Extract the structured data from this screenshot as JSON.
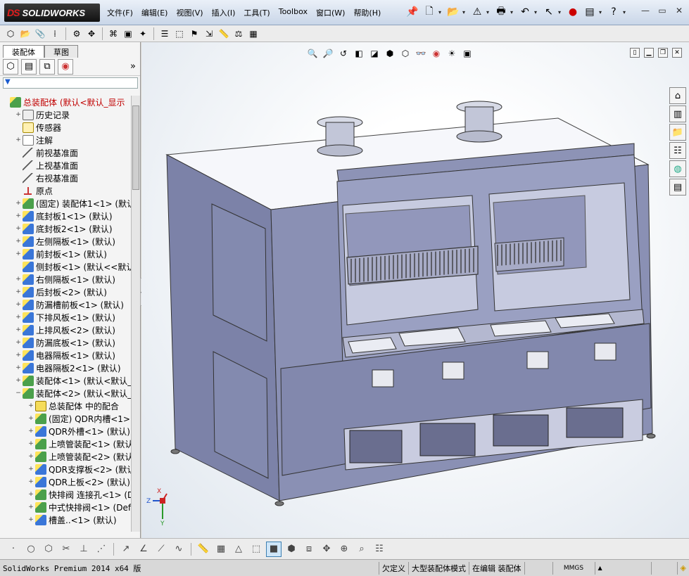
{
  "app": {
    "logo_prefix": "DS",
    "logo_text": "SOLIDWORKS"
  },
  "menu": [
    {
      "label": "文件(F)"
    },
    {
      "label": "编辑(E)"
    },
    {
      "label": "视图(V)"
    },
    {
      "label": "插入(I)"
    },
    {
      "label": "工具(T)"
    },
    {
      "label": "Toolbox"
    },
    {
      "label": "窗口(W)"
    },
    {
      "label": "帮助(H)"
    }
  ],
  "left_panel": {
    "tabs": [
      {
        "label": "装配体"
      },
      {
        "label": "草图"
      }
    ],
    "filter_icon": "filter-icon",
    "tree": [
      {
        "indent": 0,
        "expander": "",
        "icon": "asm",
        "label": "总装配体  (默认<默认_显示",
        "color": "#c00000"
      },
      {
        "indent": 1,
        "expander": "+",
        "icon": "hist",
        "label": "历史记录"
      },
      {
        "indent": 1,
        "expander": "",
        "icon": "sensor",
        "label": "传感器"
      },
      {
        "indent": 1,
        "expander": "+",
        "icon": "note",
        "label": "注解"
      },
      {
        "indent": 1,
        "expander": "",
        "icon": "plane",
        "label": "前视基准面"
      },
      {
        "indent": 1,
        "expander": "",
        "icon": "plane",
        "label": "上视基准面"
      },
      {
        "indent": 1,
        "expander": "",
        "icon": "plane",
        "label": "右视基准面"
      },
      {
        "indent": 1,
        "expander": "",
        "icon": "origin",
        "label": "原点"
      },
      {
        "indent": 1,
        "expander": "+",
        "icon": "asm",
        "label": "(固定) 装配体1<1> (默认<"
      },
      {
        "indent": 1,
        "expander": "+",
        "icon": "part",
        "label": "底封板1<1> (默认)"
      },
      {
        "indent": 1,
        "expander": "+",
        "icon": "part",
        "label": "底封板2<1> (默认)"
      },
      {
        "indent": 1,
        "expander": "+",
        "icon": "part",
        "label": "左侧隔板<1> (默认)"
      },
      {
        "indent": 1,
        "expander": "+",
        "icon": "part",
        "label": "前封板<1> (默认)"
      },
      {
        "indent": 1,
        "expander": "",
        "icon": "part",
        "label": "侧封板<1> (默认<<默认>_显"
      },
      {
        "indent": 1,
        "expander": "+",
        "icon": "part",
        "label": "右侧隔板<1> (默认)"
      },
      {
        "indent": 1,
        "expander": "+",
        "icon": "part",
        "label": "后封板<2> (默认)"
      },
      {
        "indent": 1,
        "expander": "+",
        "icon": "part",
        "label": "防漏槽前板<1> (默认)"
      },
      {
        "indent": 1,
        "expander": "+",
        "icon": "part",
        "label": "下排风板<1> (默认)"
      },
      {
        "indent": 1,
        "expander": "+",
        "icon": "part",
        "label": "上排风板<2> (默认)"
      },
      {
        "indent": 1,
        "expander": "+",
        "icon": "part",
        "label": "防漏底板<1> (默认)"
      },
      {
        "indent": 1,
        "expander": "+",
        "icon": "part",
        "label": "电器隔板<1> (默认)"
      },
      {
        "indent": 1,
        "expander": "+",
        "icon": "part",
        "label": "电器隔板2<1> (默认)"
      },
      {
        "indent": 1,
        "expander": "+",
        "icon": "asm",
        "label": "装配体<1> (默认<默认_显"
      },
      {
        "indent": 1,
        "expander": "−",
        "icon": "asm",
        "label": "装配体<2> (默认<默认_显"
      },
      {
        "indent": 2,
        "expander": "+",
        "icon": "mate",
        "label": "总装配体 中的配合"
      },
      {
        "indent": 2,
        "expander": "+",
        "icon": "asm",
        "label": "(固定) QDR内槽<1> (默"
      },
      {
        "indent": 2,
        "expander": "+",
        "icon": "part",
        "label": "QDR外槽<1> (默认)"
      },
      {
        "indent": 2,
        "expander": "+",
        "icon": "asm",
        "label": "上喷管装配<1> (默认<"
      },
      {
        "indent": 2,
        "expander": "+",
        "icon": "asm",
        "label": "上喷管装配<2> (默认<"
      },
      {
        "indent": 2,
        "expander": "+",
        "icon": "part",
        "label": "QDR支撑板<2> (默认)"
      },
      {
        "indent": 2,
        "expander": "+",
        "icon": "part",
        "label": "QDR上板<2> (默认)"
      },
      {
        "indent": 2,
        "expander": "+",
        "icon": "asm",
        "label": "快排阀 连接孔<1> (De"
      },
      {
        "indent": 2,
        "expander": "+",
        "icon": "asm",
        "label": "中式快排阀<1> (Defau"
      },
      {
        "indent": 2,
        "expander": "+",
        "icon": "part",
        "label": "槽盖..<1> (默认)"
      }
    ]
  },
  "status": {
    "app_version": "SolidWorks Premium 2014 x64 版",
    "under_defined": "欠定义",
    "large_assembly": "大型装配体模式",
    "editing": "在编辑 装配体",
    "units": "MMGS",
    "units_arrow": "▲"
  },
  "triad": {
    "x": "X",
    "y": "Y",
    "z": "Z"
  }
}
